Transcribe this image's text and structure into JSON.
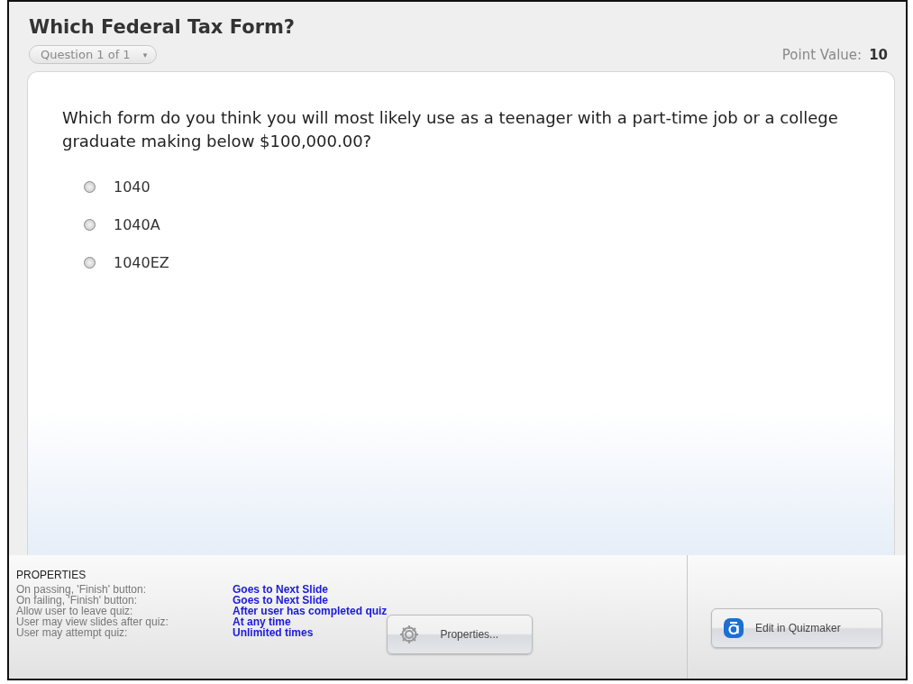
{
  "title": "Which Federal Tax Form?",
  "question_selector": {
    "label": "Question 1 of 1",
    "caret": "▾"
  },
  "point_value": {
    "label": "Point Value:",
    "value": "10"
  },
  "question": "Which form do you think you will most likely use as a teenager with a part-time job or a college graduate making below $100,000.00?",
  "choices": [
    {
      "label": "1040",
      "selected": false
    },
    {
      "label": "1040A",
      "selected": false
    },
    {
      "label": "1040EZ",
      "selected": false
    }
  ],
  "properties": {
    "heading": "PROPERTIES",
    "rows": [
      {
        "label": "On passing, 'Finish' button:",
        "value": "Goes to Next Slide"
      },
      {
        "label": "On failing, 'Finish' button:",
        "value": "Goes to Next Slide"
      },
      {
        "label": "Allow user to leave quiz:",
        "value": "After user has completed quiz"
      },
      {
        "label": "User may view slides after quiz:",
        "value": "At any time"
      },
      {
        "label": "User may attempt quiz:",
        "value": "Unlimited times"
      }
    ]
  },
  "buttons": [
    {
      "kind": "properties",
      "label": "Properties..."
    },
    {
      "kind": "quizmaker",
      "label": "Edit in Quizmaker"
    }
  ]
}
